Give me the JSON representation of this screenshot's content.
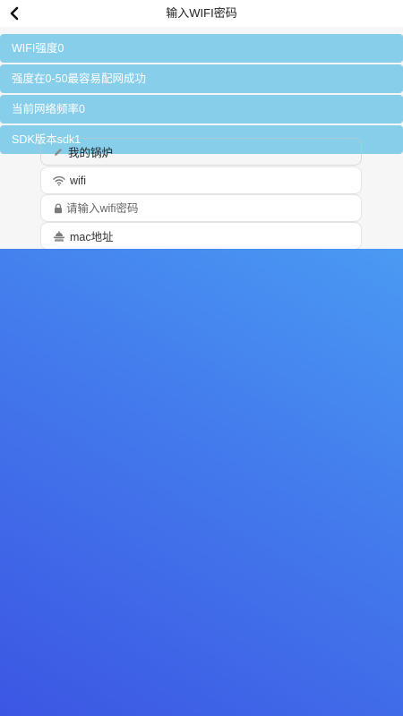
{
  "header": {
    "title": "输入WIFI密码",
    "back_icon": "chevron-left-icon"
  },
  "info": {
    "rows": [
      "WIFI强度0",
      "强度在0-50最容易配网成功",
      "当前网络频率0",
      "SDK版本sdk1"
    ]
  },
  "form": {
    "boiler_name": {
      "value": "我的锅炉",
      "icon": "pencil-icon"
    },
    "wifi_name": {
      "value": "wifi",
      "icon": "wifi-icon"
    },
    "password": {
      "placeholder": "请输入wifi密码",
      "icon": "lock-icon"
    },
    "mac": {
      "value": "mac地址",
      "icon": "mac-device-icon"
    }
  },
  "colors": {
    "info_bg": "#87ceeb",
    "gradient_top": "#4a9af3",
    "gradient_bottom": "#3c56e3"
  }
}
